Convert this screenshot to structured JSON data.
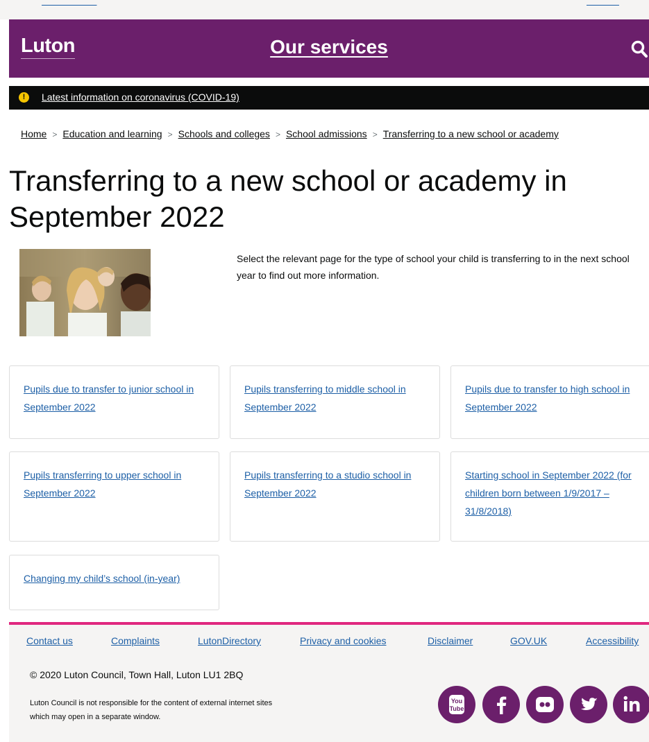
{
  "header": {
    "logo": "Luton",
    "services_label": "Our services"
  },
  "alert": {
    "icon_text": "!",
    "link": "Latest information on coronavirus (COVID-19)"
  },
  "breadcrumb": {
    "items": [
      "Home",
      "Education and learning",
      "Schools and colleges",
      "School admissions",
      "Transferring to a new school or academy"
    ],
    "separator": ">"
  },
  "page": {
    "title": "Transferring to a new school or academy in September 2022",
    "intro": "Select the relevant page for the type of school your child is transferring to in the next school year to find out more information."
  },
  "cards": [
    "Pupils due to transfer to junior school in September 2022",
    "Pupils transferring to middle school in September 2022",
    "Pupils due to transfer to high school in September 2022",
    "Pupils transferring to upper school in September 2022",
    "Pupils transferring to a studio school in September 2022",
    "Starting school in September 2022 (for children born between 1/9/2017 – 31/8/2018)",
    "Changing my child’s school (in-year)"
  ],
  "footer": {
    "links": [
      "Contact us",
      "Complaints",
      "LutonDirectory",
      "Privacy and cookies",
      "Disclaimer",
      "GOV.UK",
      "Accessibility"
    ],
    "copyright": "© 2020 Luton Council, Town Hall, Luton LU1 2BQ",
    "disclaimer": "Luton Council is not responsible for the content of external internet sites which may open in a separate window.",
    "social": [
      "youtube-icon",
      "facebook-icon",
      "flickr-icon",
      "twitter-icon",
      "linkedin-icon"
    ],
    "youtube_text_top": "You",
    "youtube_text_bottom": "Tube"
  },
  "colors": {
    "brand": "#6b1f6b",
    "accent": "#e0287f",
    "link": "#1d5fa6",
    "alert_bg": "#0b0c0c",
    "alert_icon": "#f5c400"
  }
}
